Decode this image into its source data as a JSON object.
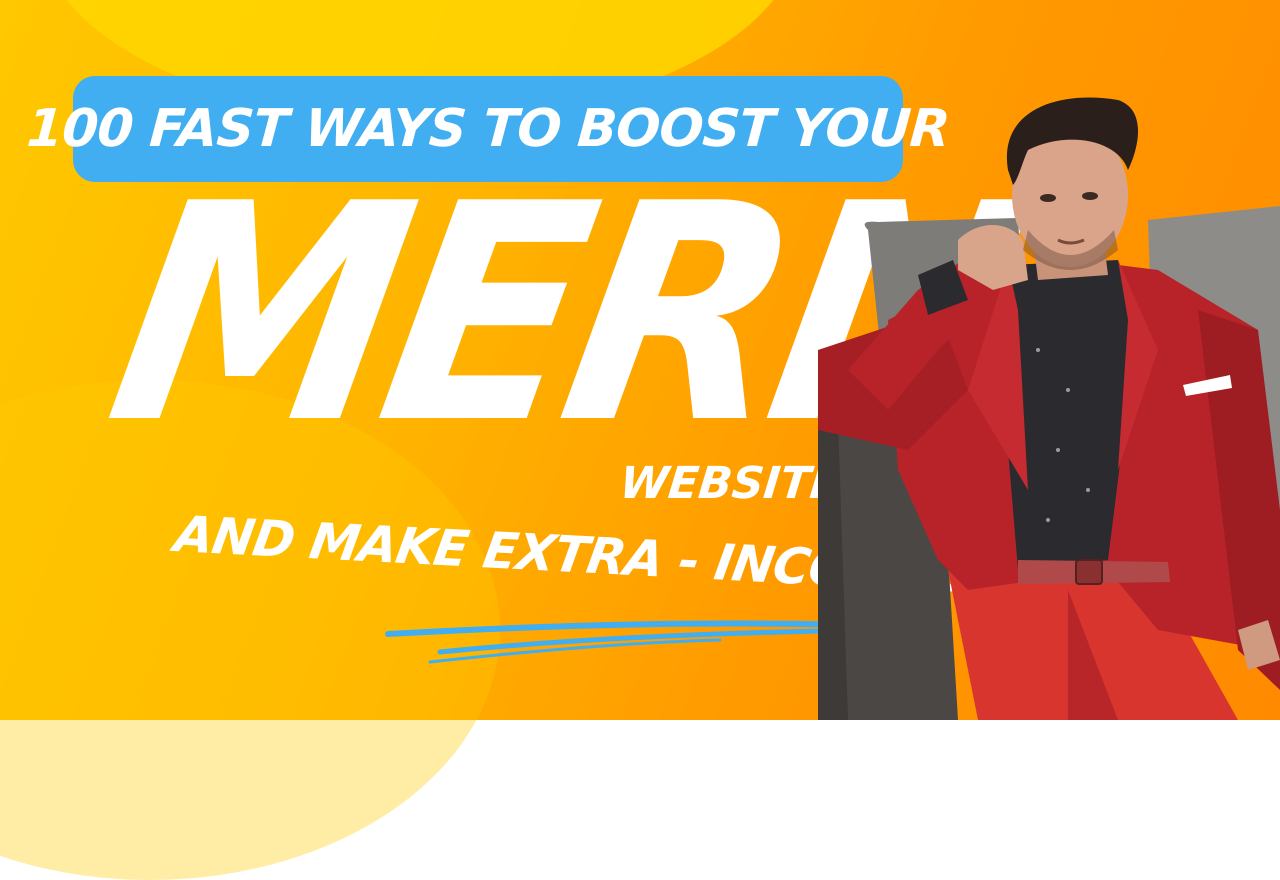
{
  "thumbnail": {
    "headline": "100 FAST WAYS TO BOOST YOUR",
    "big_word": "MERN",
    "sub_word": "WEBSITE",
    "tagline": "AND MAKE EXTRA - INCOMES!"
  },
  "colors": {
    "background_primary": "#ffb400",
    "background_secondary": "#ff8a00",
    "pill": "#40aef0",
    "text": "#ffffff",
    "underline": "#40aef0",
    "jacket": "#b8232a",
    "shirt": "#2b2b2f",
    "sofa": "#8a8a88"
  },
  "image": {
    "subject": "man-in-red-suit-on-sofa"
  }
}
